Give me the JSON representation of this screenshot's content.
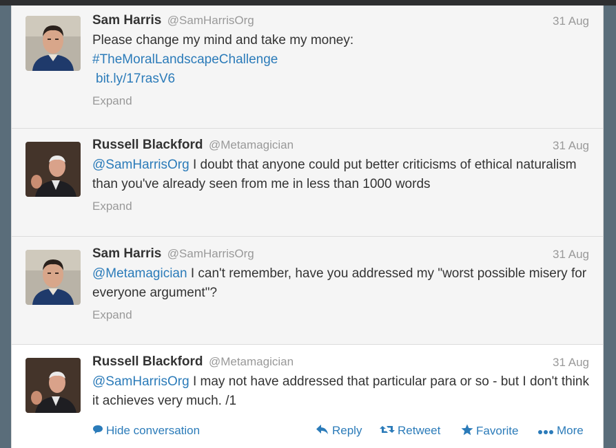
{
  "colors": {
    "link": "#2b7bb9",
    "text": "#333333",
    "muted": "#999999",
    "panel": "#f5f5f5"
  },
  "tweets": [
    {
      "name": "Sam Harris",
      "handle": "@SamHarrisOrg",
      "date": "31 Aug",
      "line1": "Please change my mind and take my money:",
      "hashtag": "#TheMoralLandscapeChallenge",
      "url": "bit.ly/17rasV6",
      "expand": "Expand",
      "avatar_icon": "sam-harris-avatar"
    },
    {
      "name": "Russell Blackford",
      "handle": "@Metamagician",
      "date": "31 Aug",
      "mention": "@SamHarrisOrg",
      "text": " I doubt that anyone could put better criticisms of ethical naturalism than you've already seen from me in less than 1000 words",
      "expand": "Expand",
      "avatar_icon": "russell-blackford-avatar"
    },
    {
      "name": "Sam Harris",
      "handle": "@SamHarrisOrg",
      "date": "31 Aug",
      "mention": "@Metamagician",
      "text": " I can't remember, have you addressed my \"worst possible misery for everyone argument\"?",
      "expand": "Expand",
      "avatar_icon": "sam-harris-avatar"
    },
    {
      "name": "Russell Blackford",
      "handle": "@Metamagician",
      "date": "31 Aug",
      "mention": "@SamHarrisOrg",
      "text": " I may not have addressed that particular para or so - but I don't think it achieves very much. /1",
      "avatar_icon": "russell-blackford-avatar"
    }
  ],
  "actions": {
    "hide_conversation": "Hide conversation",
    "reply": "Reply",
    "retweet": "Retweet",
    "favorite": "Favorite",
    "more": "More"
  }
}
